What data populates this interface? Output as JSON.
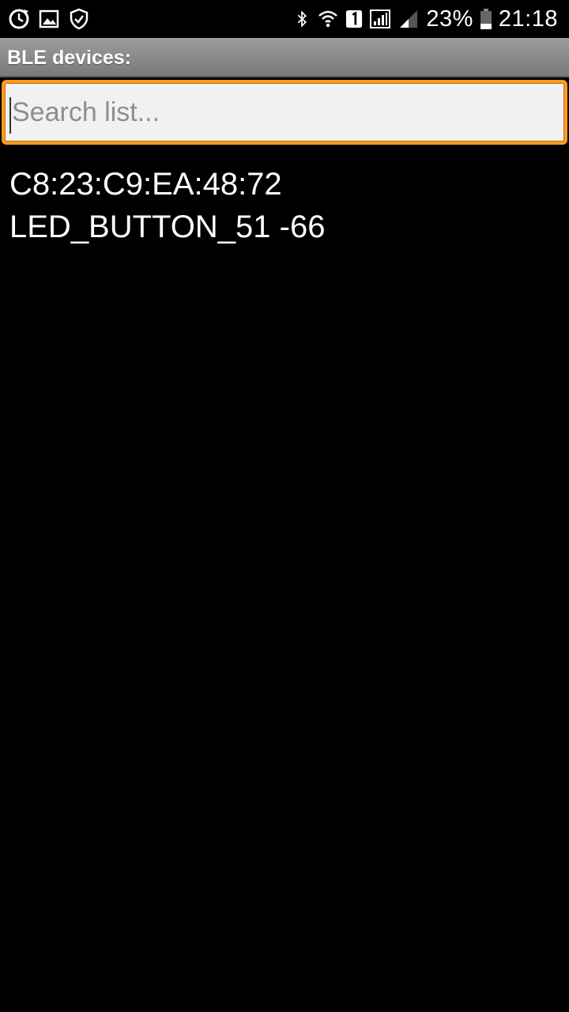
{
  "status_bar": {
    "left_icons": [
      "sync-icon",
      "image-icon",
      "shield-check-icon"
    ],
    "right_icons": [
      "bluetooth-icon",
      "wifi-icon",
      "sim-1-icon",
      "signal-icon",
      "signal-weak-icon",
      "battery-icon"
    ],
    "battery_percent": "23%",
    "time": "21:18"
  },
  "app_bar": {
    "title": "BLE devices:"
  },
  "search": {
    "value": "",
    "placeholder": "Search list..."
  },
  "devices": [
    {
      "address": "C8:23:C9:EA:48:72",
      "name_rssi": "LED_BUTTON_51 -66"
    }
  ],
  "colors": {
    "background": "#000000",
    "accent": "#ff9a1f",
    "titlebar": "#8a8a8a"
  }
}
